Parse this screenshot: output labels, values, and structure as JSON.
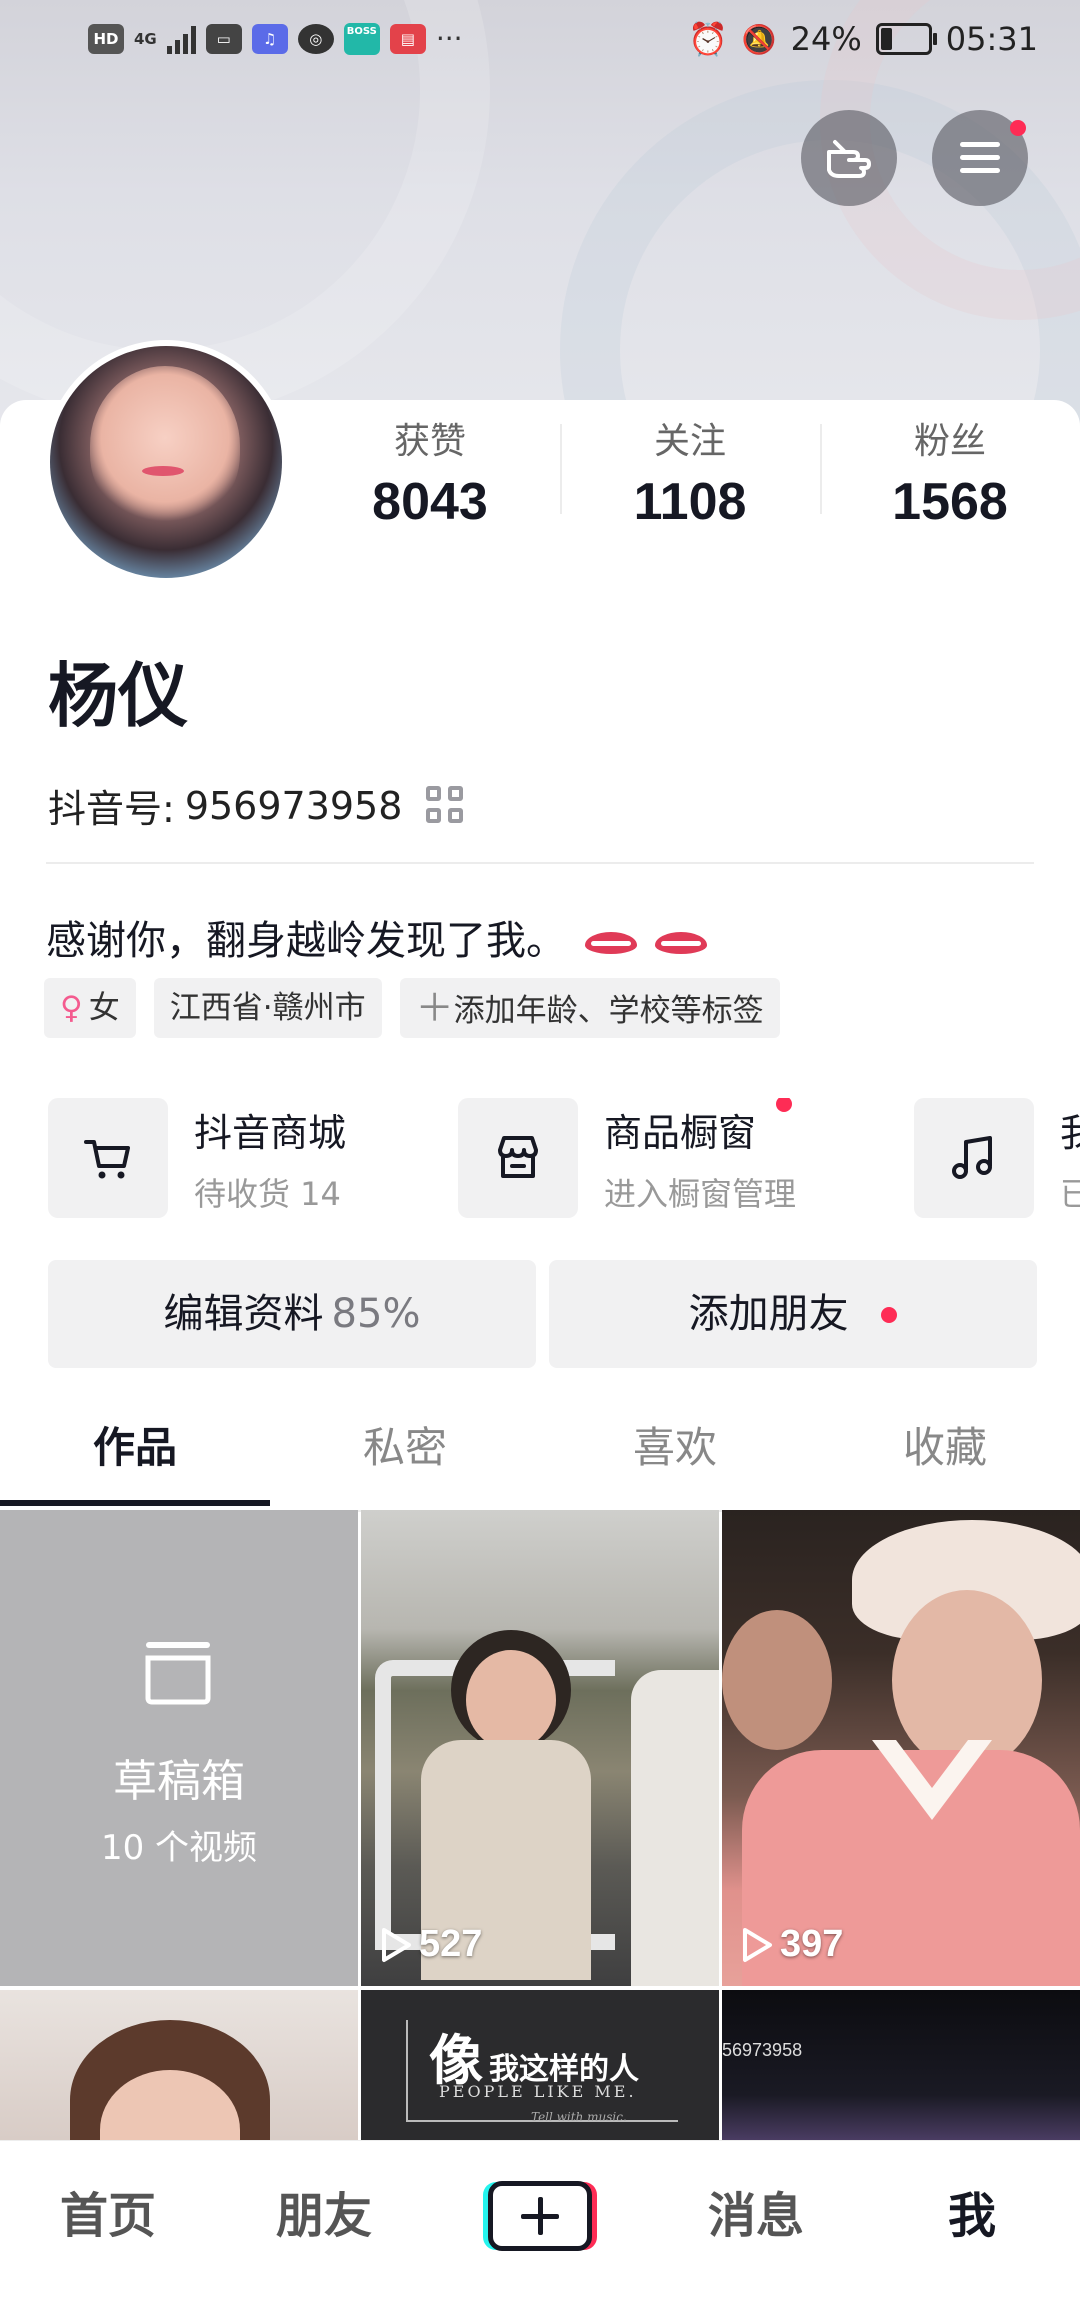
{
  "status_bar": {
    "left_icons": [
      "hd-icon",
      "signal-4g-icon",
      "huawei-app-icon",
      "music-app-icon",
      "browser-icon",
      "boss-zhipin-icon",
      "book-app-icon"
    ],
    "hd_label": "HD",
    "net_label": "4G",
    "more": "···",
    "battery_percent": "24%",
    "time": "05:31",
    "battery_level": 0.24
  },
  "profile": {
    "stats": [
      {
        "label": "获赞",
        "value": "8043"
      },
      {
        "label": "关注",
        "value": "1108"
      },
      {
        "label": "粉丝",
        "value": "1568"
      }
    ],
    "name": "杨仪",
    "douyin_id_label": "抖音号:",
    "douyin_id": "956973958",
    "bio": "感谢你，翻身越岭发现了我。",
    "tags": {
      "gender": "女",
      "location": "江西省·赣州市",
      "add_tags": "添加年龄、学校等标签"
    }
  },
  "services": [
    {
      "title": "抖音商城",
      "subtitle": "待收货 14",
      "icon": "cart-icon"
    },
    {
      "title": "商品橱窗",
      "subtitle": "进入橱窗管理",
      "icon": "shop-window-icon",
      "badge": true
    },
    {
      "title": "我",
      "subtitle": "已",
      "icon": "music-note-icon"
    }
  ],
  "actions": {
    "edit_profile": "编辑资料",
    "edit_percent": "85%",
    "add_friends": "添加朋友"
  },
  "tabs": [
    "作品",
    "私密",
    "喜欢",
    "收藏"
  ],
  "grid": {
    "drafts_title": "草稿箱",
    "drafts_count": "10 个视频",
    "videos": [
      {
        "plays": "527"
      },
      {
        "plays": "397"
      }
    ],
    "thumb_text_1": "像",
    "thumb_text_2": "我这样的人",
    "thumb_text_3": "PEOPLE LIKE ME.",
    "thumb_text_4": "Tell with music.",
    "thumb_text_5": "56973958"
  },
  "bottom_nav": [
    "首页",
    "朋友",
    "消息",
    "我"
  ],
  "colors": {
    "accent_red": "#fe2c55",
    "accent_cyan": "#25f4ee",
    "text_primary": "#161823"
  }
}
